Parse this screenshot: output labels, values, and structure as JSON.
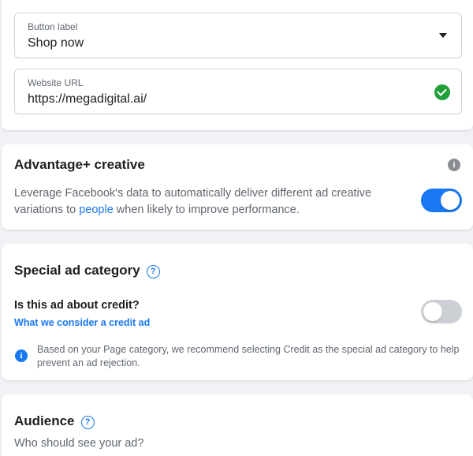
{
  "destination": {
    "button_label": {
      "label": "Button label",
      "value": "Shop now"
    },
    "website_url": {
      "label": "Website URL",
      "value": "https://megadigital.ai/"
    }
  },
  "advantage_creative": {
    "title": "Advantage+ creative",
    "description_before": "Leverage Facebook's data to automatically deliver different ad creative variations to ",
    "description_link": "people",
    "description_after": " when likely to improve performance.",
    "toggle_on": true
  },
  "special_ad_category": {
    "title": "Special ad category",
    "question": "Is this ad about credit?",
    "link": "What we consider a credit ad",
    "toggle_on": false,
    "notice": "Based on your Page category, we recommend selecting Credit as the special ad category to help prevent an ad rejection."
  },
  "audience": {
    "title": "Audience",
    "subtitle": "Who should see your ad?"
  },
  "colors": {
    "accent": "#1877f2",
    "success": "#20a03a",
    "muted_text": "#606770"
  }
}
